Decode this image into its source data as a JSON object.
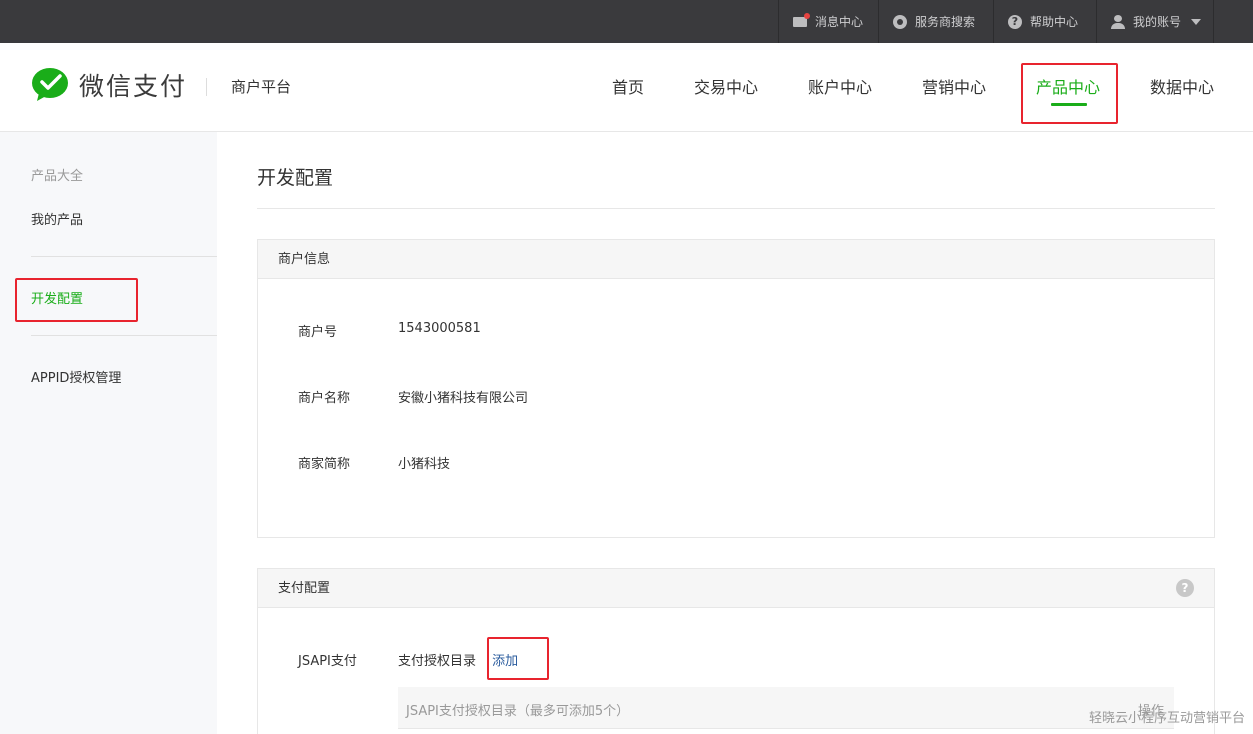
{
  "topbar": {
    "messages": "消息中心",
    "provider_search": "服务商搜索",
    "help": "帮助中心",
    "account": "我的账号"
  },
  "header": {
    "logo_text": "微信支付",
    "platform": "商户平台",
    "nav": [
      "首页",
      "交易中心",
      "账户中心",
      "营销中心",
      "产品中心",
      "数据中心"
    ],
    "active_nav": "产品中心",
    "accent_color": "#1aad19"
  },
  "sidebar": {
    "title": "产品大全",
    "items": [
      "我的产品",
      "开发配置",
      "APPID授权管理"
    ],
    "active": "开发配置"
  },
  "main": {
    "page_title": "开发配置",
    "merchant_panel": {
      "title": "商户信息",
      "rows": [
        {
          "label": "商户号",
          "value": "1543000581"
        },
        {
          "label": "商户名称",
          "value": "安徽小猪科技有限公司"
        },
        {
          "label": "商家简称",
          "value": "小猪科技"
        }
      ]
    },
    "pay_panel": {
      "title": "支付配置",
      "help_glyph": "?",
      "jsapi_label": "JSAPI支付",
      "auth_dir_label": "支付授权目录",
      "add_label": "添加",
      "table_col1": "JSAPI支付授权目录（最多可添加5个）",
      "table_col2": "操作"
    }
  },
  "watermark": "轻晓云小程序互动营销平台"
}
